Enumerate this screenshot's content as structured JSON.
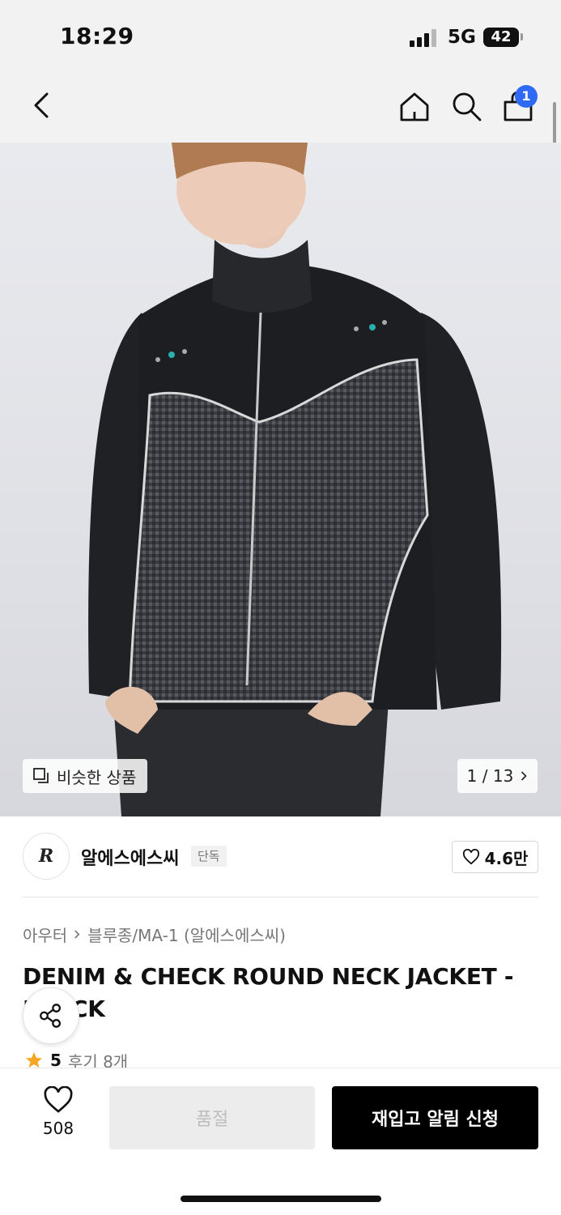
{
  "status_bar": {
    "time": "18:29",
    "network": "5G",
    "battery": "42"
  },
  "nav": {
    "cart_count": "1",
    "icons": [
      "chevron-left-icon",
      "home-icon",
      "search-icon",
      "shopping-bag-icon"
    ]
  },
  "gallery": {
    "similar_label": "비슷한 상품",
    "page_current": "1",
    "page_total": "13"
  },
  "brand": {
    "logo_text": "R",
    "name": "알에스에스씨",
    "tag": "단독",
    "likes": "4.6만"
  },
  "breadcrumb": {
    "category": "아우터",
    "subcategory": "블루종/MA-1 (알에스에스씨)"
  },
  "product": {
    "title": "DENIM & CHECK ROUND NECK JACKET - BLACK",
    "rating": "5",
    "reviews": "후기 8개"
  },
  "actions": {
    "wish_count": "508",
    "soldout_label": "품절",
    "restock_label": "재입고 알림 신청"
  },
  "colors": {
    "badge": "#2f6af5",
    "star": "#f5a623",
    "primary_button": "#000000",
    "disabled_button": "#ececec"
  }
}
